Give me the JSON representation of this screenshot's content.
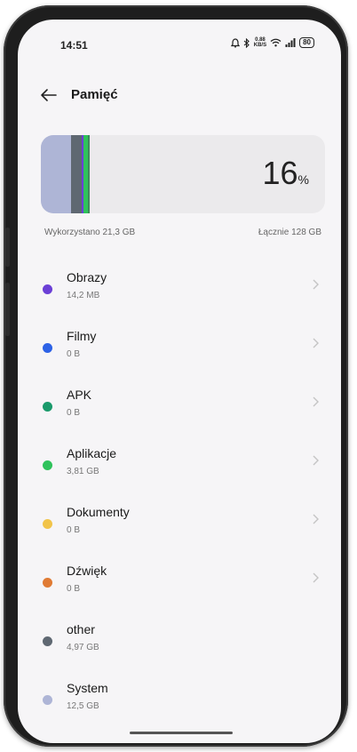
{
  "status_bar": {
    "time": "14:51",
    "net_speed_value": "0.88",
    "net_speed_unit": "KB/S",
    "battery": "80",
    "icons": [
      "alarm-icon",
      "bluetooth-icon",
      "wifi-icon",
      "signal-icon",
      "battery-icon"
    ]
  },
  "header": {
    "title": "Pamięć",
    "back_icon": "arrow-left-icon"
  },
  "storage": {
    "percent_value": "16",
    "percent_sign": "%",
    "used_fraction": 0.16,
    "used_label": "Wykorzystano 21,3 GB",
    "total_label": "Łącznie 128 GB"
  },
  "categories": [
    {
      "name": "Obrazy",
      "size": "14,2 MB",
      "color": "#6b3fd6",
      "has_chevron": true
    },
    {
      "name": "Filmy",
      "size": "0 B",
      "color": "#2d62e6",
      "has_chevron": true
    },
    {
      "name": "APK",
      "size": "0 B",
      "color": "#1a9a6b",
      "has_chevron": true
    },
    {
      "name": "Aplikacje",
      "size": "3,81  GB",
      "color": "#2fc25b",
      "has_chevron": true
    },
    {
      "name": "Dokumenty",
      "size": "0 B",
      "color": "#f1c44a",
      "has_chevron": true
    },
    {
      "name": "Dźwięk",
      "size": "0 B",
      "color": "#e07b34",
      "has_chevron": true
    },
    {
      "name": "other",
      "size": "4,97 GB",
      "color": "#5f6872",
      "has_chevron": false
    },
    {
      "name": "System",
      "size": "12,5 GB",
      "color": "#aeb5d6",
      "has_chevron": false
    }
  ],
  "colors": {
    "screen_bg": "#f6f5f7",
    "card_bg": "#ebeaec",
    "system_segment": "#aeb5d6",
    "other_segment": "#5f6872",
    "apps_segment": "#2fc25b"
  }
}
